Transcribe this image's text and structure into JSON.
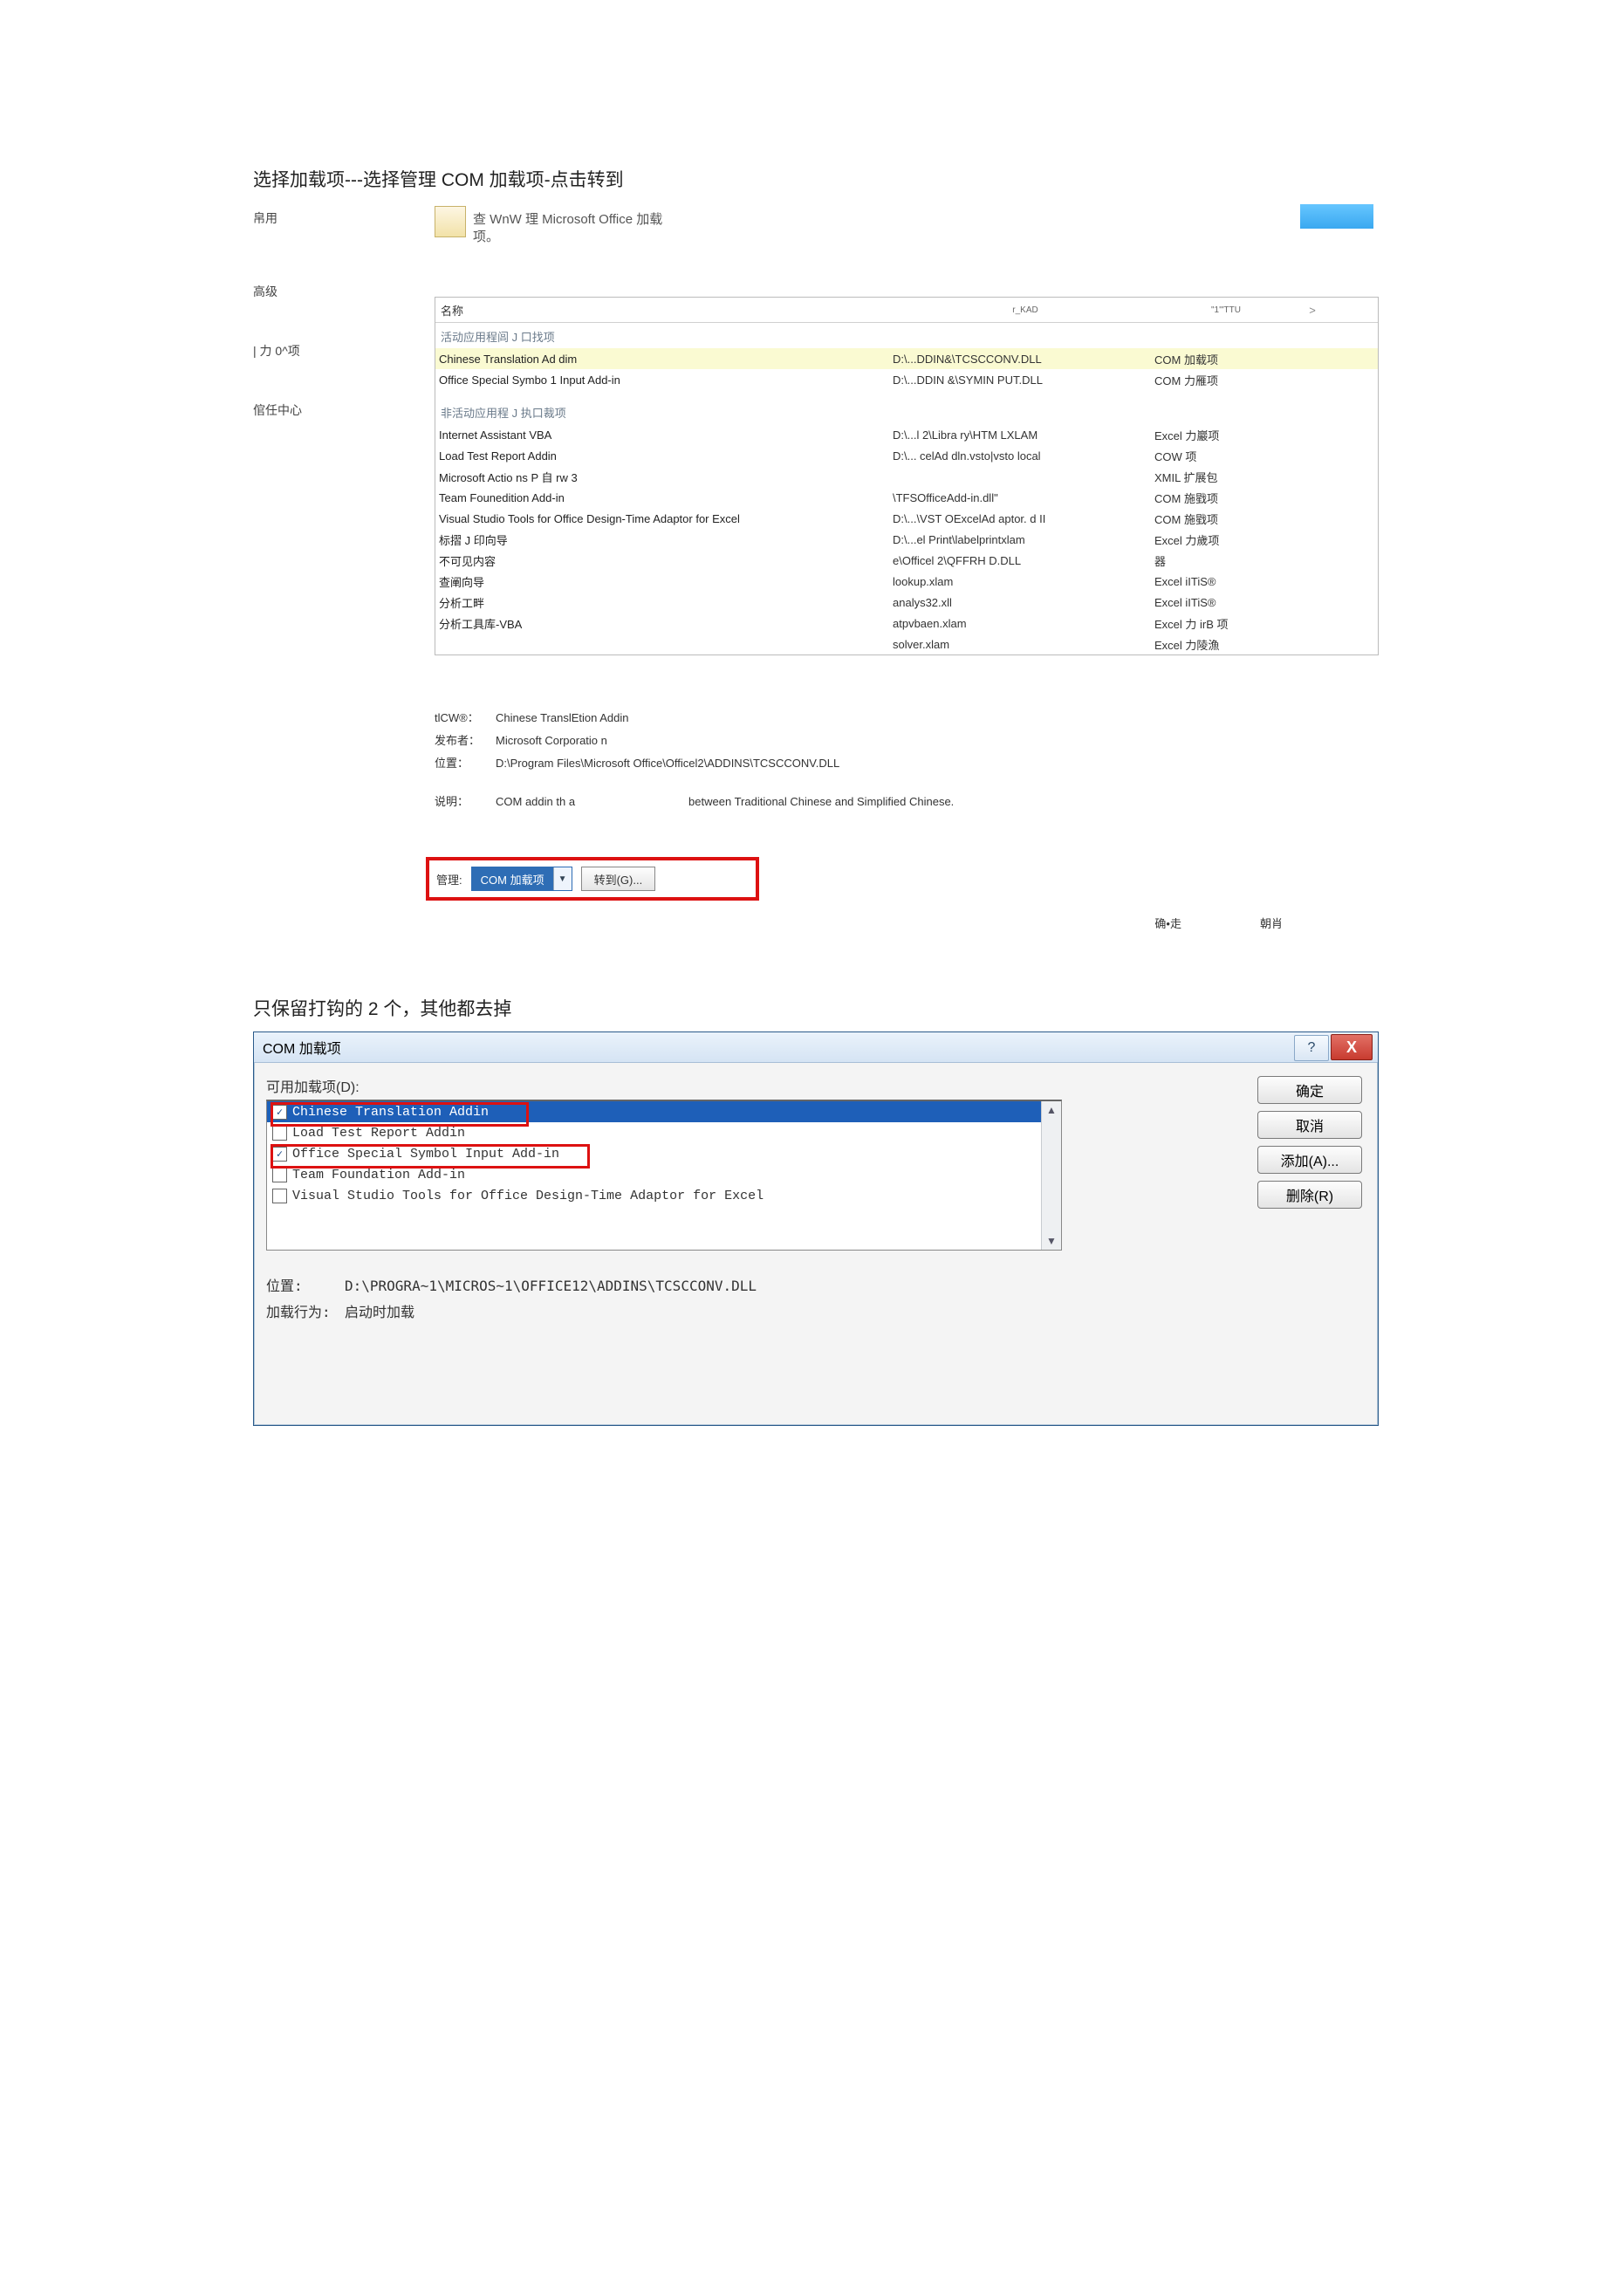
{
  "instr1": "选择加载项---选择管理 COM 加载项-点击转到",
  "instr2": "只保留打钩的 2 个，其他都去掉",
  "options": {
    "side_items": [
      "帛用",
      "高级",
      "| 力 0^项",
      "倌任中心"
    ],
    "top_line1": "查 WnW 理 Microsoft Office 加载",
    "top_line2": "项。",
    "head": {
      "name": "名称",
      "col2": "r_KAD",
      "col3": "\"1'\"TTU",
      "col4": ">"
    },
    "sect_active": "活动应用程闾 J 口找项",
    "active": [
      {
        "n": "Chinese Translation Ad dim",
        "p": "D:\\...DDIN&\\TCSCCONV.DLL",
        "t": "COM 加载项"
      },
      {
        "n": "Office Special Symbo 1 Input Add-in",
        "p": "D:\\...DDIN &\\SYMIN PUT.DLL",
        "t": "COM 力雁项"
      }
    ],
    "sect_inactive": "非活动应用程 J 执口裁项",
    "inactive": [
      {
        "n": "Internet Assistant VBA",
        "p": "D:\\...l 2\\Libra ry\\HTM LXLAM",
        "t": "Excel 力巖项"
      },
      {
        "n": "Load Test Report Addin",
        "p": "D:\\... celAd dln.vsto|vsto local",
        "t": "COW 项"
      },
      {
        "n": "Microsoft Actio ns P 自 rw 3",
        "p": "",
        "t": "XMIL 扩展包"
      },
      {
        "n": "Team Founedition Add-in",
        "p": "\\TFSOfficeAdd-in.dll\"",
        "t": "COM 施戥项"
      },
      {
        "n": "Visual Studio Tools for Office Design-Time Adaptor for Excel",
        "p": "D:\\...\\VST OExcelAd aptor. d II",
        "t": "COM 施戥项"
      },
      {
        "n": "标摺 J 印向导",
        "p": "D:\\...el Print\\labelprintxlam",
        "t": "Excel 力歲项"
      },
      {
        "n": "不可见内容",
        "p": "e\\Officel 2\\QFFRH D.DLL",
        "t": "器"
      },
      {
        "n": "查阐向导",
        "p": "lookup.xlam",
        "t": "Excel iITiS®"
      },
      {
        "n": "分析工畔",
        "p": "analys32.xll",
        "t": "Excel iITiS®"
      },
      {
        "n": "分析工具库-VBA",
        "p": "atpvbaen.xlam",
        "t": "Excel 力 irB 项"
      },
      {
        "n": "",
        "p": "solver.xlam",
        "t": "Excel 力陵漁"
      }
    ],
    "detail": {
      "addin_lbl": "tlCW®：",
      "addin_val": "Chinese TranslEtion Addin",
      "pub_lbl": "发布者：",
      "pub_val": "Microsoft Corporatio n",
      "loc_lbl": "位置：",
      "loc_val": "D:\\Program Files\\Microsoft Office\\Officel2\\ADDINS\\TCSCCONV.DLL",
      "desc_lbl": "说明：",
      "desc_val1": "COM addin th a",
      "desc_val2": "between Traditional Chinese and Simplified Chinese."
    },
    "manage_lbl": "管理:",
    "manage_val": "COM 加载项",
    "goto_label": "转到(G)...",
    "ok": "确•走",
    "cancel": "朝肖"
  },
  "dialog": {
    "title": "COM 加载项",
    "help": "?",
    "close": "X",
    "avail": "可用加载项(D):",
    "items": [
      {
        "label": "Chinese Translation Addin",
        "checked": true,
        "selected": true
      },
      {
        "label": "Load Test Report Addin",
        "checked": false,
        "selected": false
      },
      {
        "label": "Office Special Symbol Input Add-in",
        "checked": true,
        "selected": false
      },
      {
        "label": "Team Foundation Add-in",
        "checked": false,
        "selected": false
      },
      {
        "label": "Visual Studio Tools for Office Design-Time Adaptor for Excel",
        "checked": false,
        "selected": false
      }
    ],
    "buttons": {
      "ok": "确定",
      "cancel": "取消",
      "add": "添加(A)...",
      "remove": "删除(R)"
    },
    "loc_lbl": "位置:",
    "loc_val": "D:\\PROGRA~1\\MICROS~1\\OFFICE12\\ADDINS\\TCSCCONV.DLL",
    "beh_lbl": "加载行为:",
    "beh_val": "启动时加载"
  }
}
